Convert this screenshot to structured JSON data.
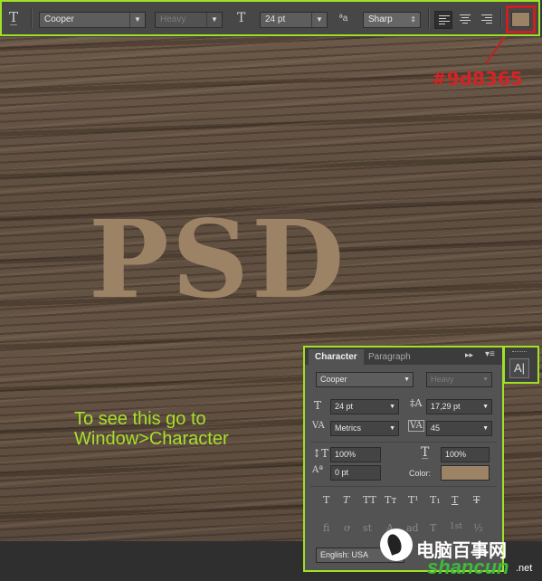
{
  "options_bar": {
    "tool_icon": "horizontal-type-tool-icon",
    "font_family": "Cooper",
    "font_style": "Heavy",
    "font_size": "24 pt",
    "antialias": "Sharp",
    "color_hex": "#9d8365",
    "highlight_color": "#a0e025"
  },
  "annotation": {
    "color_label": "#9d8365",
    "annotation_color": "#d12424"
  },
  "canvas": {
    "text": "PSD"
  },
  "hint": {
    "line1": "To see this go to",
    "line2": "Window>Character"
  },
  "character_panel": {
    "tabs": [
      "Character",
      "Paragraph"
    ],
    "font_family": "Cooper",
    "font_style": "Heavy",
    "font_size": "24 pt",
    "leading": "17,29 pt",
    "kerning": "Metrics",
    "tracking": "45",
    "vertical_scale": "100%",
    "horizontal_scale": "100%",
    "baseline_shift": "0 pt",
    "color_label": "Color:",
    "color_hex": "#9d8365",
    "style_buttons": [
      "T",
      "T",
      "TT",
      "Tт",
      "T¹",
      "T₁",
      "T",
      "T"
    ],
    "opentype_buttons": [
      "fi",
      "ơ",
      "st",
      "A",
      "ad",
      "T",
      "1st",
      "½"
    ],
    "language": "English: USA"
  },
  "watermark": {
    "text": "电脑百事网",
    "url_text": "shancun",
    "url_suffix": ".net"
  }
}
